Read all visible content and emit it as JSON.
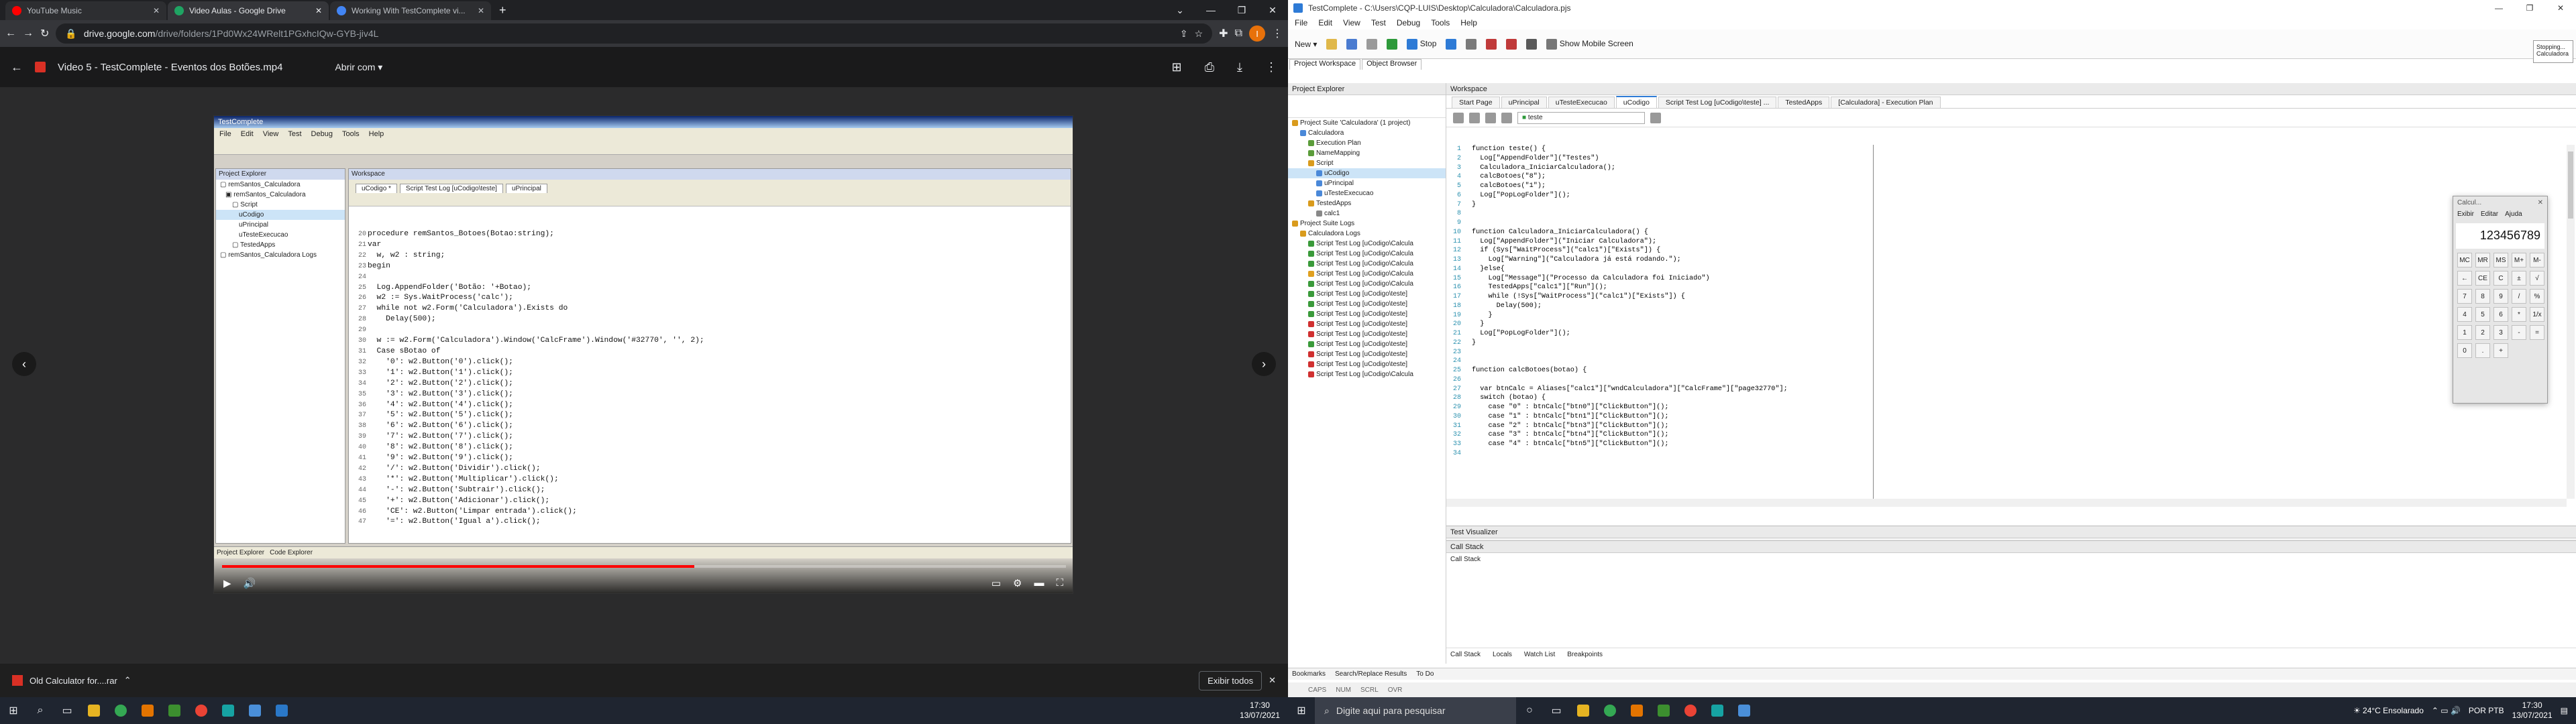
{
  "left": {
    "tabs": [
      {
        "label": "YouTube Music",
        "color": "#ff0000"
      },
      {
        "label": "Video Aulas - Google Drive",
        "color": "#1fa463"
      },
      {
        "label": "Working With TestComplete vi...",
        "color": "#4285f4"
      }
    ],
    "url_host": "drive.google.com",
    "url_path": "/drive/folders/1Pd0Wx24WRelt1PGxhcIQw-GYB-jiv4L",
    "avatar": "I",
    "video_title": "Video 5 - TestComplete - Eventos dos Botões.mp4",
    "open_with": "Abrir com",
    "code_lines": [
      "procedure remSantos_Botoes(Botao:string);",
      "var",
      "  w, w2 : string;",
      "begin",
      "",
      "  Log.AppendFolder('Botão: '+Botao);",
      "  w2 := Sys.WaitProcess('calc');",
      "  while not w2.Form('Calculadora').Exists do",
      "    Delay(500);",
      "",
      "  w := w2.Form('Calculadora').Window('CalcFrame').Window('#32770', '', 2);",
      "  Case sBotao of",
      "    '0': w2.Button('0').click();",
      "    '1': w2.Button('1').click();",
      "    '2': w2.Button('2').click();",
      "    '3': w2.Button('3').click();",
      "    '4': w2.Button('4').click();",
      "    '5': w2.Button('5').click();",
      "    '6': w2.Button('6').click();",
      "    '7': w2.Button('7').click();",
      "    '8': w2.Button('8').click();",
      "    '9': w2.Button('9').click();",
      "    '/': w2.Button('Dividir').click();",
      "    '*': w2.Button('Multiplicar').click();",
      "    '-': w2.Button('Subtrair').click();",
      "    '+': w2.Button('Adicionar').click();",
      "    'CE': w2.Button('Limpar entrada').click();",
      "    '=': w2.Button('Igual a').click();"
    ],
    "line_numbers": "20\n21\n22\n23\n24\n25\n26\n27\n28\n29\n30\n31\n32\n33\n34\n35\n36\n37\n38\n39\n40\n41\n42\n43\n44\n45\n46\n47",
    "video_progress": 0.56,
    "download_file": "Old Calculator for....rar",
    "show_all": "Exibir todos",
    "clock_time": "17:30",
    "clock_date": "13/07/2021"
  },
  "right": {
    "title": "TestComplete - C:\\Users\\CQP-LUIS\\Desktop\\Calculadora\\Calculadora.pjs",
    "menu": [
      "File",
      "Edit",
      "View",
      "Test",
      "Debug",
      "Tools",
      "Help"
    ],
    "stop_label": "Stop",
    "mobile_label": "Show Mobile Screen",
    "top_tabs": [
      "Project Workspace",
      "Object Browser"
    ],
    "project_explorer": "Project Explorer",
    "workspace": "Workspace",
    "tree": [
      {
        "t": "Project Suite 'Calculadora' (1 project)",
        "d": 0,
        "c": "#d99b1d"
      },
      {
        "t": "Calculadora",
        "d": 1,
        "c": "#4a88d8"
      },
      {
        "t": "Execution Plan",
        "d": 2,
        "c": "#5b9c3a"
      },
      {
        "t": "NameMapping",
        "d": 2,
        "c": "#5b9c3a"
      },
      {
        "t": "Script",
        "d": 2,
        "c": "#d99b1d"
      },
      {
        "t": "uCodigo",
        "d": 3,
        "c": "#4a88d8",
        "sel": true
      },
      {
        "t": "uPrincipal",
        "d": 3,
        "c": "#4a88d8"
      },
      {
        "t": "uTesteExecucao",
        "d": 3,
        "c": "#4a88d8"
      },
      {
        "t": "TestedApps",
        "d": 2,
        "c": "#d99b1d"
      },
      {
        "t": "calc1",
        "d": 3,
        "c": "#888"
      },
      {
        "t": "Project Suite Logs",
        "d": 0,
        "c": "#d99b1d"
      },
      {
        "t": "Calculadora Logs",
        "d": 1,
        "c": "#d99b1d"
      },
      {
        "t": "Script Test Log [uCodigo\\Calcula",
        "d": 2,
        "c": "#3a9a3a"
      },
      {
        "t": "Script Test Log [uCodigo\\Calcula",
        "d": 2,
        "c": "#3a9a3a"
      },
      {
        "t": "Script Test Log [uCodigo\\Calcula",
        "d": 2,
        "c": "#3a9a3a"
      },
      {
        "t": "Script Test Log [uCodigo\\Calcula",
        "d": 2,
        "c": "#e0a020"
      },
      {
        "t": "Script Test Log [uCodigo\\Calcula",
        "d": 2,
        "c": "#3a9a3a"
      },
      {
        "t": "Script Test Log [uCodigo\\teste]",
        "d": 2,
        "c": "#3a9a3a"
      },
      {
        "t": "Script Test Log [uCodigo\\teste]",
        "d": 2,
        "c": "#3a9a3a"
      },
      {
        "t": "Script Test Log [uCodigo\\teste]",
        "d": 2,
        "c": "#3a9a3a"
      },
      {
        "t": "Script Test Log [uCodigo\\teste]",
        "d": 2,
        "c": "#d03030"
      },
      {
        "t": "Script Test Log [uCodigo\\teste]",
        "d": 2,
        "c": "#d03030"
      },
      {
        "t": "Script Test Log [uCodigo\\teste]",
        "d": 2,
        "c": "#3a9a3a"
      },
      {
        "t": "Script Test Log [uCodigo\\teste]",
        "d": 2,
        "c": "#d03030"
      },
      {
        "t": "Script Test Log [uCodigo\\teste]",
        "d": 2,
        "c": "#d03030"
      },
      {
        "t": "Script Test Log [uCodigo\\Calcula",
        "d": 2,
        "c": "#d03030"
      }
    ],
    "editor_tabs": [
      "Start Page",
      "uPrincipal",
      "uTesteExecucao",
      "uCodigo",
      "Script Test Log [uCodigo\\teste] ...",
      "TestedApps",
      "[Calculadora] - Execution Plan"
    ],
    "routine": "teste",
    "code_lines": [
      "function teste() {",
      "  Log[\"AppendFolder\"](\"Testes\")",
      "  Calculadora_IniciarCalculadora();",
      "  calcBotoes(\"8\");",
      "  calcBotoes(\"1\");",
      "  Log[\"PopLogFolder\"]();",
      "}",
      "",
      "",
      "function Calculadora_IniciarCalculadora() {",
      "  Log[\"AppendFolder\"](\"Iniciar Calculadora\");",
      "  if (Sys[\"WaitProcess\"](\"calc1\")[\"Exists\"]) {",
      "    Log[\"Warning\"](\"Calculadora já está rodando.\");",
      "  }else{",
      "    Log[\"Message\"](\"Processo da Calculadora foi Iniciado\")",
      "    TestedApps[\"calc1\"][\"Run\"]();",
      "    while (!Sys[\"WaitProcess\"](\"calc1\")[\"Exists\"]) {",
      "      Delay(500);",
      "    }",
      "  }",
      "  Log[\"PopLogFolder\"]();",
      "}",
      "",
      "",
      "function calcBotoes(botao) {",
      "",
      "  var btnCalc = Aliases[\"calc1\"][\"wndCalculadora\"][\"CalcFrame\"][\"page32770\"];",
      "  switch (botao) {",
      "    case \"0\" : btnCalc[\"btn0\"][\"ClickButton\"]();",
      "    case \"1\" : btnCalc[\"btn1\"][\"ClickButton\"]();",
      "    case \"2\" : btnCalc[\"btn3\"][\"ClickButton\"]();",
      "    case \"3\" : btnCalc[\"btn4\"][\"ClickButton\"]();",
      "    case \"4\" : btnCalc[\"btn5\"][\"ClickButton\"]();"
    ],
    "line_numbers": "1\n2\n3\n4\n5\n6\n7\n8\n9\n10\n11\n12\n13\n14\n15\n16\n17\n18\n19\n20\n21\n22\n23\n24\n25\n26\n27\n28\n29\n30\n31\n32\n33\n34",
    "calc": {
      "title": "Calcul...",
      "menu": [
        "Exibir",
        "Editar",
        "Ajuda"
      ],
      "display": "123456789",
      "keys": [
        "MC",
        "MR",
        "MS",
        "M+",
        "M-",
        "←",
        "CE",
        "C",
        "±",
        "√",
        "7",
        "8",
        "9",
        "/",
        "%",
        "4",
        "5",
        "6",
        "*",
        "1/x",
        "1",
        "2",
        "3",
        "-",
        "=",
        "0",
        ".",
        "+"
      ]
    },
    "test_visualizer": "Test Visualizer",
    "call_stack_title": "Call Stack",
    "call_stack_label": "Call Stack",
    "bottom_tabs_1": [
      "Call Stack",
      "Locals",
      "Watch List",
      "Breakpoints"
    ],
    "bottom_tabs_2": [
      "Bookmarks",
      "Search/Replace Results",
      "To Do"
    ],
    "status": [
      "CAPS",
      "NUM",
      "SCRL",
      "OVR"
    ],
    "side_mini": [
      "Stopping...",
      "Calculadora"
    ],
    "search_placeholder": "Digite aqui para pesquisar",
    "weather": "24°C Ensolarado",
    "lang": "POR PTB",
    "clock_time": "17:30",
    "clock_date": "13/07/2021"
  }
}
